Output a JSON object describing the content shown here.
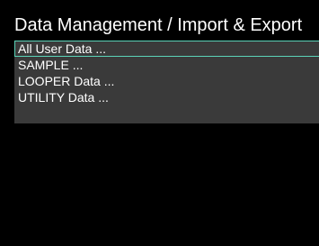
{
  "header": {
    "title": "Data Management / Import & Export"
  },
  "menu": {
    "items": [
      {
        "label": "All User Data ...",
        "selected": true
      },
      {
        "label": "SAMPLE ...",
        "selected": false
      },
      {
        "label": "LOOPER Data ...",
        "selected": false
      },
      {
        "label": "UTILITY Data ...",
        "selected": false
      }
    ]
  },
  "colors": {
    "background": "#000000",
    "panel": "#3a3a3a",
    "text": "#ffffff",
    "selection_border": "#5bd3b8"
  }
}
